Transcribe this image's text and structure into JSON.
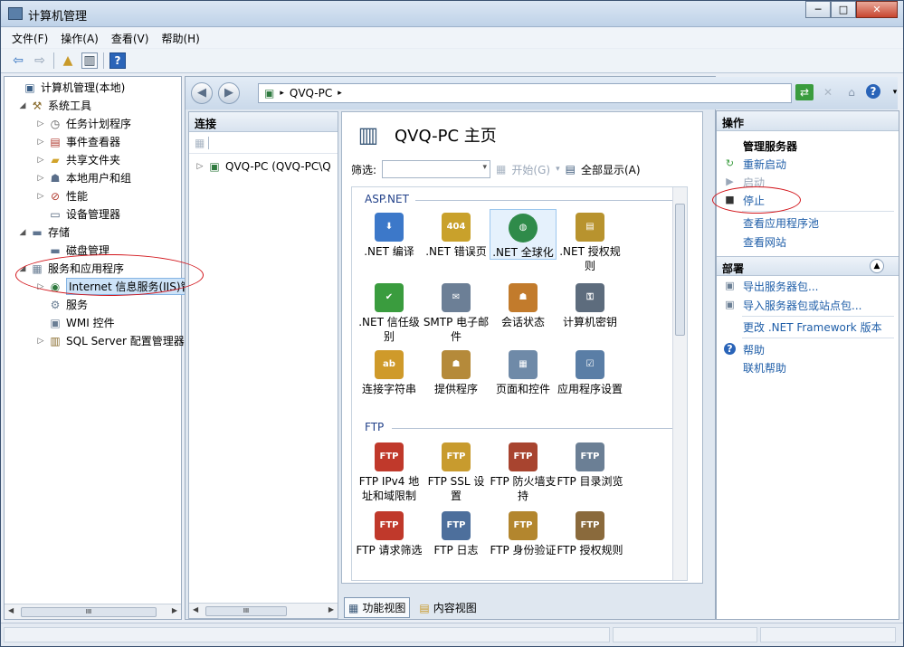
{
  "window": {
    "title": "计算机管理"
  },
  "window_buttons": [
    "─",
    "□",
    "✕"
  ],
  "menu": [
    "文件(F)",
    "操作(A)",
    "查看(V)",
    "帮助(H)"
  ],
  "tree": {
    "items": [
      {
        "label": "计算机管理(本地)",
        "icon": "computer-management-icon",
        "expander": ""
      },
      {
        "label": "系统工具",
        "icon": "system-tools-icon",
        "expander": "◢"
      },
      {
        "label": "任务计划程序",
        "icon": "task-scheduler-icon",
        "expander": "▷"
      },
      {
        "label": "事件查看器",
        "icon": "event-viewer-icon",
        "expander": "▷"
      },
      {
        "label": "共享文件夹",
        "icon": "shared-folders-icon",
        "expander": "▷"
      },
      {
        "label": "本地用户和组",
        "icon": "local-users-icon",
        "expander": "▷"
      },
      {
        "label": "性能",
        "icon": "performance-icon",
        "expander": "▷"
      },
      {
        "label": "设备管理器",
        "icon": "device-manager-icon",
        "expander": ""
      },
      {
        "label": "存储",
        "icon": "storage-icon",
        "expander": "◢"
      },
      {
        "label": "磁盘管理",
        "icon": "disk-management-icon",
        "expander": ""
      },
      {
        "label": "服务和应用程序",
        "icon": "services-applications-icon",
        "expander": "◢"
      },
      {
        "label": "Internet 信息服务(IIS)管",
        "icon": "iis-icon",
        "expander": "▷"
      },
      {
        "label": "服务",
        "icon": "services-icon",
        "expander": ""
      },
      {
        "label": "WMI 控件",
        "icon": "wmi-icon",
        "expander": ""
      },
      {
        "label": "SQL Server 配置管理器",
        "icon": "sql-server-icon",
        "expander": "▷"
      }
    ],
    "scrollbar": "III"
  },
  "address": {
    "host": "QVQ-PC",
    "separator": "▸"
  },
  "connections": {
    "header": "连接",
    "node": "QVQ-PC (QVQ-PC\\Q",
    "scrollbar": "III"
  },
  "home": {
    "title": "QVQ-PC 主页",
    "filter_label": "筛选:",
    "start_label": "开始(G)",
    "showall_label": "全部显示(A)",
    "sections": [
      {
        "name": "ASP.NET",
        "features": [
          {
            "label": ".NET 编译",
            "icon": "net-compilation-icon",
            "color": "#3c78c9"
          },
          {
            "label": ".NET 错误页",
            "icon": "net-error-pages-icon",
            "color": "#c9a12b"
          },
          {
            "label": ".NET 全球化",
            "icon": "net-globalization-icon",
            "color": "#2f8b4a"
          },
          {
            "label": ".NET 授权规则",
            "icon": "net-authorization-icon",
            "color": "#b8932e"
          },
          {
            "label": ".NET 信任级别",
            "icon": "net-trust-levels-icon",
            "color": "#3a9c3e"
          },
          {
            "label": "SMTP 电子邮件",
            "icon": "smtp-email-icon",
            "color": "#6c7f96"
          },
          {
            "label": "会话状态",
            "icon": "session-state-icon",
            "color": "#c27b2c"
          },
          {
            "label": "计算机密钥",
            "icon": "machine-key-icon",
            "color": "#5d6c7d"
          },
          {
            "label": "连接字符串",
            "icon": "connection-strings-icon",
            "color": "#cf9a2a"
          },
          {
            "label": "提供程序",
            "icon": "providers-icon",
            "color": "#b58a3a"
          },
          {
            "label": "页面和控件",
            "icon": "pages-controls-icon",
            "color": "#6f8aa8"
          },
          {
            "label": "应用程序设置",
            "icon": "app-settings-icon",
            "color": "#5a7ea6"
          }
        ]
      },
      {
        "name": "FTP",
        "features": [
          {
            "label": "FTP IPv4 地址和域限制",
            "icon": "ftp-ipv4-icon",
            "color": "#c0392b"
          },
          {
            "label": "FTP SSL 设置",
            "icon": "ftp-ssl-icon",
            "color": "#c89b2e"
          },
          {
            "label": "FTP 防火墙支持",
            "icon": "ftp-firewall-icon",
            "color": "#a8442f"
          },
          {
            "label": "FTP 目录浏览",
            "icon": "ftp-directory-icon",
            "color": "#6b7f95"
          },
          {
            "label": "FTP 请求筛选",
            "icon": "ftp-request-filtering-icon",
            "color": "#c0392b"
          },
          {
            "label": "FTP 日志",
            "icon": "ftp-logging-icon",
            "color": "#4d6f9c"
          },
          {
            "label": "FTP 身份验证",
            "icon": "ftp-authentication-icon",
            "color": "#b3862e"
          },
          {
            "label": "FTP 授权规则",
            "icon": "ftp-authorization-icon",
            "color": "#8a6a3c"
          }
        ]
      }
    ],
    "view_tabs": [
      "功能视图",
      "内容视图"
    ]
  },
  "actions": {
    "header": "操作",
    "manage_server": "管理服务器",
    "restart": "重新启动",
    "start": "启动",
    "stop": "停止",
    "view_app_pools": "查看应用程序池",
    "view_sites": "查看网站",
    "deploy_header": "部署",
    "export_package": "导出服务器包...",
    "import_package": "导入服务器包或站点包...",
    "change_framework": "更改 .NET Framework 版本",
    "help": "帮助",
    "online_help": "联机帮助"
  },
  "annotation_color": "#d2141a"
}
